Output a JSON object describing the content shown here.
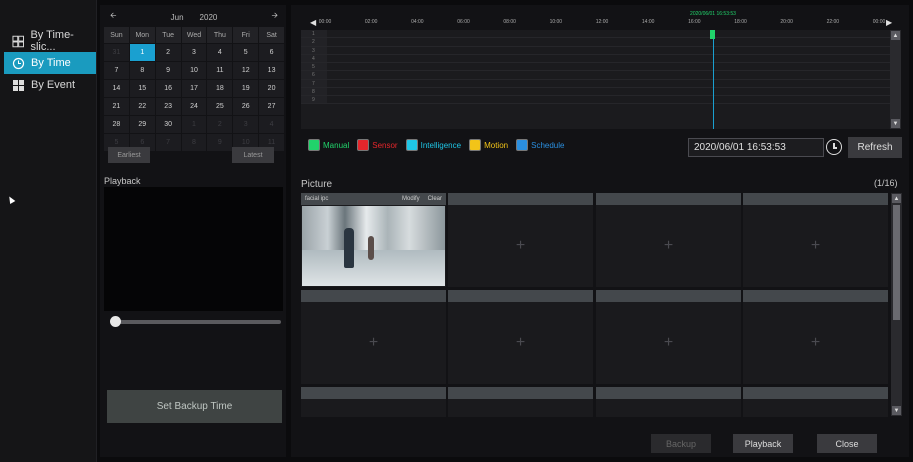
{
  "nav": {
    "items": [
      {
        "label": "By Time-slic...",
        "icon": "time-slice-icon",
        "active": false
      },
      {
        "label": "By Time",
        "icon": "clock-icon",
        "active": true
      },
      {
        "label": "By Event",
        "icon": "event-grid-icon",
        "active": false
      }
    ]
  },
  "calendar": {
    "month": "Jun",
    "year": "2020",
    "dow": [
      "Sun",
      "Mon",
      "Tue",
      "Wed",
      "Thu",
      "Fri",
      "Sat"
    ],
    "days": [
      [
        "31",
        "1",
        "2",
        "3",
        "4",
        "5",
        "6"
      ],
      [
        "7",
        "8",
        "9",
        "10",
        "11",
        "12",
        "13"
      ],
      [
        "14",
        "15",
        "16",
        "17",
        "18",
        "19",
        "20"
      ],
      [
        "21",
        "22",
        "23",
        "24",
        "25",
        "26",
        "27"
      ],
      [
        "28",
        "29",
        "30",
        "1",
        "2",
        "3",
        "4"
      ],
      [
        "5",
        "6",
        "7",
        "8",
        "9",
        "10",
        "11"
      ]
    ],
    "selected_day": "1",
    "earliest": "Earliest",
    "latest": "Latest"
  },
  "playback": {
    "label": "Playback",
    "slider_value": 0
  },
  "set_backup_time": "Set Backup Time",
  "timeline": {
    "ticks": [
      "00:00",
      "02:00",
      "04:00",
      "06:00",
      "08:00",
      "10:00",
      "12:00",
      "14:00",
      "16:00",
      "18:00",
      "20:00",
      "22:00",
      "00:00"
    ],
    "current": "2020/06/01 16:53:53",
    "tracks": [
      "1",
      "2",
      "3",
      "4",
      "5",
      "6",
      "7",
      "8",
      "9"
    ]
  },
  "legend": [
    {
      "label": "Manual",
      "color": "#21d36b"
    },
    {
      "label": "Sensor",
      "color": "#e5262b"
    },
    {
      "label": "Intelligence",
      "color": "#1fc6e6"
    },
    {
      "label": "Motion",
      "color": "#f2c418"
    },
    {
      "label": "Schedule",
      "color": "#2a8fe0"
    }
  ],
  "datetime_value": "2020/06/01 16:53:53",
  "refresh": "Refresh",
  "picture": {
    "label": "Picture",
    "count": "(1/16)",
    "first": {
      "name": "facial ipc",
      "modify": "Modify",
      "clear": "Clear"
    },
    "add_symbol": "+"
  },
  "buttons": {
    "backup": "Backup",
    "playback": "Playback",
    "close": "Close"
  },
  "colors": {
    "accent": "#1aa0d0",
    "cursor": "#21d36b"
  }
}
